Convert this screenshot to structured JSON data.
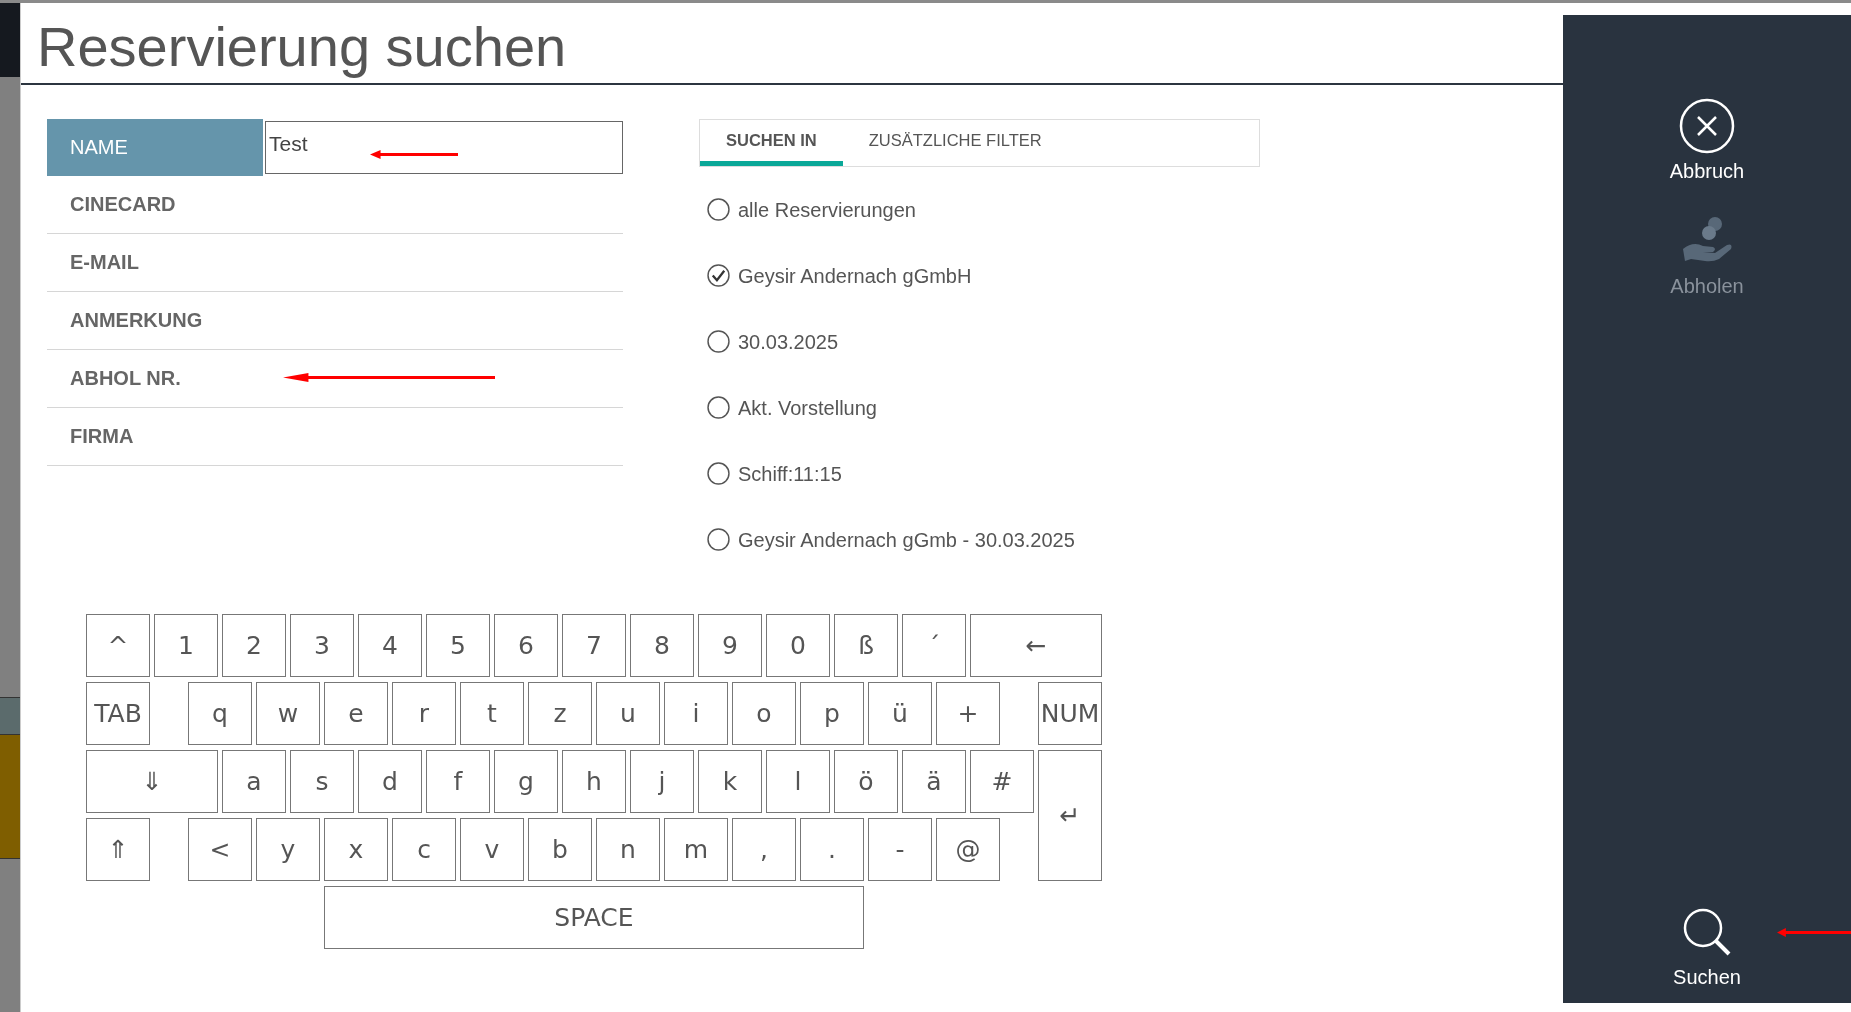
{
  "title": "Reservierung suchen",
  "fields": [
    {
      "label": "NAME",
      "selected": true,
      "value": "Test"
    },
    {
      "label": "CINECARD",
      "selected": false
    },
    {
      "label": "E-MAIL",
      "selected": false
    },
    {
      "label": "ANMERKUNG",
      "selected": false
    },
    {
      "label": "ABHOL NR.",
      "selected": false
    },
    {
      "label": "FIRMA",
      "selected": false
    }
  ],
  "tabs": [
    {
      "label": "SUCHEN IN",
      "selected": true
    },
    {
      "label": "ZUSÄTZLICHE FILTER",
      "selected": false
    }
  ],
  "options": [
    {
      "label": "alle Reservierungen",
      "selected": false
    },
    {
      "label": "Geysir Andernach gGmbH",
      "selected": true
    },
    {
      "label": "30.03.2025",
      "selected": false
    },
    {
      "label": "Akt. Vorstellung",
      "selected": false
    },
    {
      "label": "Schiff:11:15",
      "selected": false
    },
    {
      "label": "Geysir Andernach gGmb - 30.03.2025",
      "selected": false
    }
  ],
  "keyboard": [
    [
      "^",
      "1",
      "2",
      "3",
      "4",
      "5",
      "6",
      "7",
      "8",
      "9",
      "0",
      "ß",
      "´",
      "←"
    ],
    [
      "TAB",
      "q",
      "w",
      "e",
      "r",
      "t",
      "z",
      "u",
      "i",
      "o",
      "p",
      "ü",
      "+",
      "NUM"
    ],
    [
      "⇓",
      "a",
      "s",
      "d",
      "f",
      "g",
      "h",
      "j",
      "k",
      "l",
      "ö",
      "ä",
      "#",
      "↵"
    ],
    [
      "⇑",
      "<",
      "y",
      "x",
      "c",
      "v",
      "b",
      "n",
      "m",
      ",",
      ".",
      "-",
      "@"
    ],
    [
      "SPACE"
    ]
  ],
  "sidebar": [
    {
      "kind": "close",
      "label": "Abbruch",
      "disabled": false
    },
    {
      "kind": "hand",
      "label": "Abholen",
      "disabled": true
    },
    {
      "kind": "search",
      "label": "Suchen",
      "disabled": false
    }
  ],
  "annotations": [
    {
      "kind": "arrow"
    },
    {
      "kind": "arrow"
    },
    {
      "kind": "arrow"
    }
  ]
}
